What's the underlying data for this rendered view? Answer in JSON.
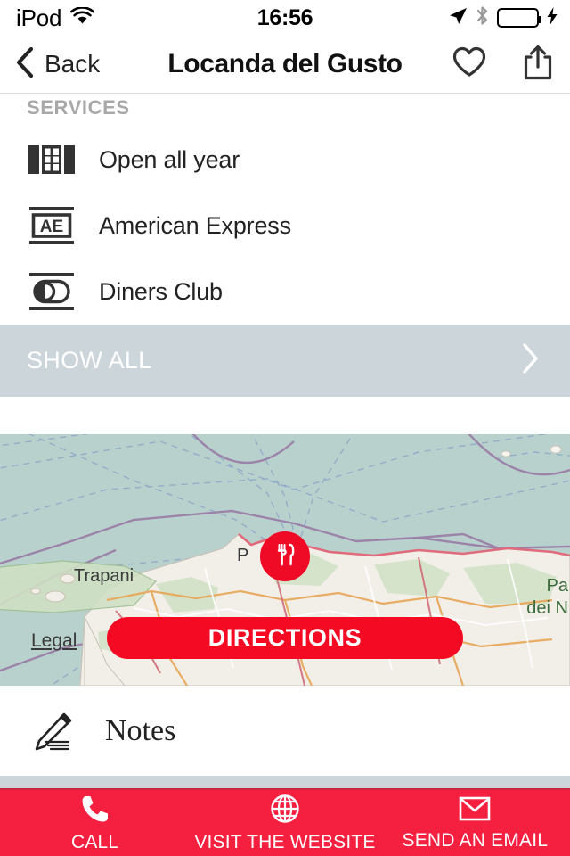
{
  "status_bar": {
    "carrier": "iPod",
    "wifi_icon": "wifi-icon",
    "time": "16:56",
    "location_icon": "location-arrow-icon",
    "bluetooth_icon": "bluetooth-icon",
    "battery_icon": "battery-full-icon",
    "charging_icon": "lightning-bolt-icon"
  },
  "nav_bar": {
    "back_label": "Back",
    "back_icon": "chevron-left-icon",
    "title": "Locanda del Gusto",
    "favorite_icon": "heart-icon",
    "share_icon": "share-icon"
  },
  "services": {
    "header": "SERVICES",
    "items": [
      {
        "label": "Open all year",
        "icon": "calendar-icon"
      },
      {
        "label": "American Express",
        "icon": "amex-card-icon"
      },
      {
        "label": "Diners Club",
        "icon": "diners-club-card-icon"
      }
    ],
    "show_all": {
      "label": "SHOW ALL",
      "chevron_icon": "chevron-right-icon"
    }
  },
  "map": {
    "legal_link": "Legal",
    "pin_icon": "restaurant-fork-knife-icon",
    "directions_label": "DIRECTIONS",
    "labels": {
      "trapani": "Trapani",
      "palermo": "P",
      "park_line1": "Pa",
      "park_line2": "dei N"
    },
    "colors": {
      "sea": "#b9d1cd",
      "land": "#f2efe9",
      "pin": "#ef0a26",
      "directions_button": "#f50a24"
    }
  },
  "notes": {
    "label": "Notes",
    "icon": "pencil-write-icon"
  },
  "toolbar": {
    "background": "#f5203f",
    "items": [
      {
        "label": "CALL",
        "icon": "phone-icon"
      },
      {
        "label": "VISIT THE WEBSITE",
        "icon": "globe-icon"
      },
      {
        "label": "SEND AN EMAIL",
        "icon": "envelope-icon"
      }
    ]
  }
}
